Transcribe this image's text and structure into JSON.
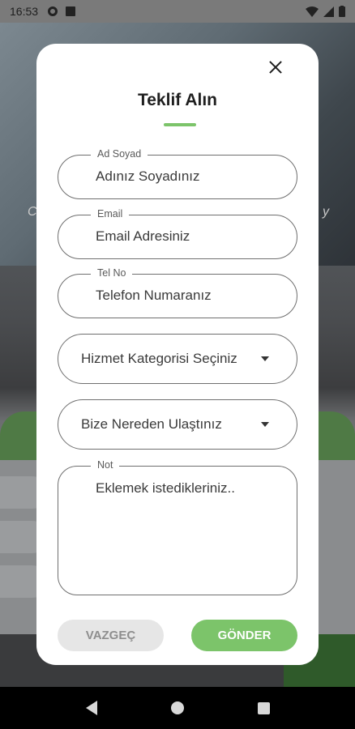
{
  "status_bar": {
    "time": "16:53",
    "icons": [
      "settings-icon",
      "sim-card-icon",
      "wifi-icon",
      "signal-icon",
      "battery-icon"
    ]
  },
  "modal": {
    "title": "Teklif Alın",
    "accent_color": "#7cc46a",
    "fields": {
      "name": {
        "label": "Ad Soyad",
        "placeholder": "Adınız Soyadınız"
      },
      "email": {
        "label": "Email",
        "placeholder": "Email Adresiniz"
      },
      "tel": {
        "label": "Tel No",
        "placeholder": "Telefon Numaranız"
      },
      "category": {
        "value": "Hizmet Kategorisi Seçiniz"
      },
      "source": {
        "value": "Bize Nereden Ulaştınız"
      },
      "note": {
        "label": "Not",
        "placeholder": "Eklemek istedikleriniz.."
      }
    },
    "buttons": {
      "cancel": "VAZGEÇ",
      "send": "GÖNDER"
    }
  },
  "background": {
    "left_fragment": "C",
    "right_fragment": "y"
  }
}
